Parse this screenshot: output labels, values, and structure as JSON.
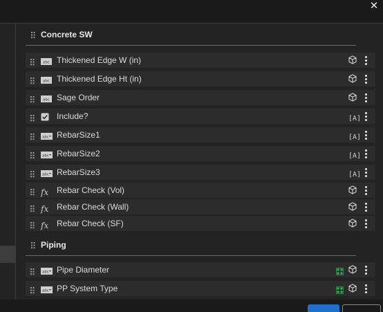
{
  "window": {
    "close_glyph": "✕"
  },
  "sections": [
    {
      "title": "Concrete SW",
      "rows": [
        {
          "label": "Thickened Edge W (in)",
          "type_icon": "text-field-icon",
          "mode_icon": "cube-icon"
        },
        {
          "label": "Thickened Edge Ht (in)",
          "type_icon": "text-field-icon",
          "mode_icon": "cube-icon"
        },
        {
          "label": "Sage Order",
          "type_icon": "text-field-icon",
          "mode_icon": "cube-icon"
        },
        {
          "label": "Include?",
          "type_icon": "checkbox-icon",
          "mode_icon": "bracket-a-icon"
        },
        {
          "label": "RebarSize1",
          "type_icon": "dropdown-field-icon",
          "mode_icon": "bracket-a-icon"
        },
        {
          "label": "RebarSize2",
          "type_icon": "dropdown-field-icon",
          "mode_icon": "bracket-a-icon"
        },
        {
          "label": "RebarSize3",
          "type_icon": "dropdown-field-icon",
          "mode_icon": "bracket-a-icon"
        },
        {
          "label": "Rebar Check (Vol)",
          "type_icon": "fx-icon",
          "mode_icon": "cube-icon"
        },
        {
          "label": "Rebar Check (Wall)",
          "type_icon": "fx-icon",
          "mode_icon": "cube-icon"
        },
        {
          "label": "Rebar Check (SF)",
          "type_icon": "fx-icon",
          "mode_icon": "cube-icon"
        }
      ]
    },
    {
      "title": "Piping",
      "rows": [
        {
          "label": "Pipe Diameter",
          "type_icon": "dropdown-field-icon",
          "mode_icon": "cube-icon",
          "extra_icon": "linked-grid-icon"
        },
        {
          "label": "PP System Type",
          "type_icon": "dropdown-field-icon",
          "mode_icon": "cube-icon",
          "extra_icon": "linked-grid-icon"
        }
      ]
    }
  ],
  "mode_text": "[A]",
  "fx_text": "fx",
  "colors": {
    "accent": "#1e6fd0",
    "panel": "#232323",
    "row": "#2c2c2c",
    "green": "#2fbf4a"
  }
}
